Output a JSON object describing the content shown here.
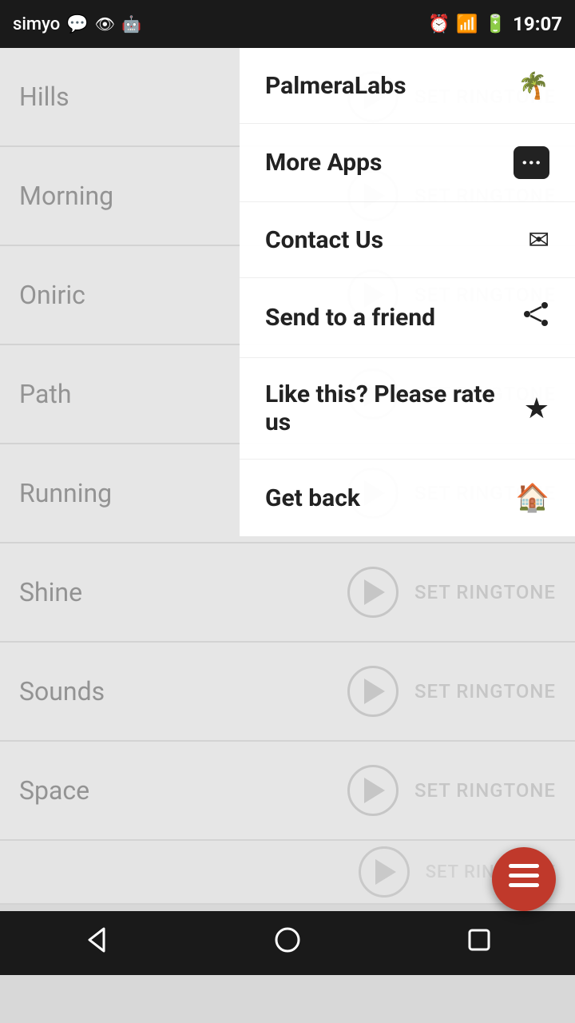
{
  "status_bar": {
    "carrier": "simyo",
    "time": "19:07"
  },
  "ringtones": [
    {
      "name": "Hills",
      "set_label": "SET RINGTONE"
    },
    {
      "name": "Morning",
      "set_label": "SET RINGTONE"
    },
    {
      "name": "Oniric",
      "set_label": "SET RINGTONE"
    },
    {
      "name": "Path",
      "set_label": "SET RINGTONE"
    },
    {
      "name": "Running",
      "set_label": "SET RINGTONE"
    },
    {
      "name": "Shine",
      "set_label": "SET RINGTONE"
    },
    {
      "name": "Sounds",
      "set_label": "SET RINGTONE"
    },
    {
      "name": "Space",
      "set_label": "SET RINGTONE"
    },
    {
      "name": "",
      "set_label": "SET RINGTONE"
    }
  ],
  "overlay_menu": {
    "items": [
      {
        "label": "PalmeraLabs",
        "icon": "🌴",
        "id": "palmera-labs"
      },
      {
        "label": "More Apps",
        "icon": "⬛",
        "id": "more-apps"
      },
      {
        "label": "Contact Us",
        "icon": "✉",
        "id": "contact-us"
      },
      {
        "label": "Send to a friend",
        "icon": "↗",
        "id": "send-friend"
      },
      {
        "label": "Like this? Please rate us",
        "icon": "★",
        "id": "rate-us"
      },
      {
        "label": "Get back",
        "icon": "🏠",
        "id": "get-back"
      }
    ]
  },
  "fab": {
    "icon": "≡"
  },
  "bottom_nav": {
    "back_label": "◁",
    "home_label": "○",
    "recent_label": "□"
  }
}
